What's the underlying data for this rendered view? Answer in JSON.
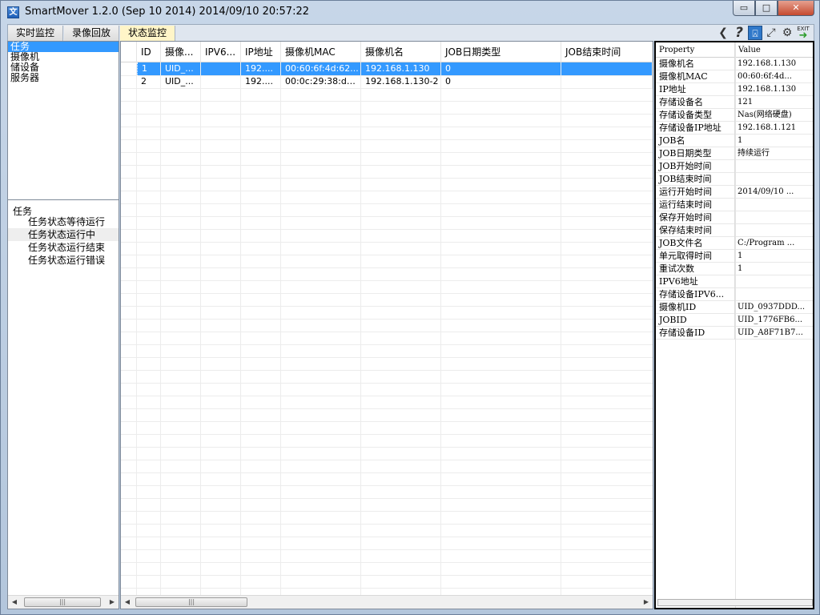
{
  "window": {
    "title": "SmartMover 1.2.0 (Sep 10 2014) 2014/09/10 20:57:22",
    "app_icon": "文",
    "controls": {
      "minimize": "▭",
      "maximize": "□",
      "close": "✕"
    }
  },
  "tabs": [
    {
      "label": "实时监控",
      "active": false
    },
    {
      "label": "录像回放",
      "active": false
    },
    {
      "label": "状态监控",
      "active": true
    }
  ],
  "toolbar": {
    "back_glyph": "❮",
    "help_glyph": "?",
    "user_glyph": "⍓",
    "fullscreen_glyph": "⤢",
    "settings_glyph": "⚙",
    "exit_label": "EXIT",
    "exit_arrow": "➜"
  },
  "categories": [
    {
      "label": "任务",
      "selected": true
    },
    {
      "label": "摄像机",
      "selected": false
    },
    {
      "label": "储设备",
      "selected": false
    },
    {
      "label": "服务器",
      "selected": false
    }
  ],
  "tree": {
    "root": "任务",
    "children": [
      {
        "label": "任务状态等待运行",
        "selected": false
      },
      {
        "label": "任务状态运行中",
        "selected": true
      },
      {
        "label": "任务状态运行结束",
        "selected": false
      },
      {
        "label": "任务状态运行错误",
        "selected": false
      }
    ]
  },
  "grid": {
    "columns": [
      "ID",
      "摄像...",
      "IPV6...",
      "IP地址",
      "摄像机MAC",
      "摄像机名",
      "JOB日期类型",
      "JOB结束时间"
    ],
    "rows": [
      {
        "id": "1",
        "cells": [
          "UID_...",
          "",
          "192....",
          "00:60:6f:4d:62...",
          "192.168.1.130",
          "0",
          ""
        ],
        "selected": true
      },
      {
        "id": "2",
        "cells": [
          "UID_...",
          "",
          "192....",
          "00:0c:29:38:da...",
          "192.168.1.130-2",
          "0",
          ""
        ],
        "selected": false
      }
    ]
  },
  "properties": {
    "header": {
      "key": "Property",
      "value": "Value"
    },
    "items": [
      {
        "key": "摄像机名",
        "value": "192.168.1.130"
      },
      {
        "key": "摄像机MAC",
        "value": "00:60:6f:4d..."
      },
      {
        "key": "IP地址",
        "value": "192.168.1.130"
      },
      {
        "key": "存储设备名",
        "value": "121"
      },
      {
        "key": "存储设备类型",
        "value": "Nas(网络硬盘)"
      },
      {
        "key": "存储设备IP地址",
        "value": "192.168.1.121"
      },
      {
        "key": "JOB名",
        "value": "1"
      },
      {
        "key": "JOB日期类型",
        "value": "持续运行"
      },
      {
        "key": "JOB开始时间",
        "value": ""
      },
      {
        "key": "JOB结束时间",
        "value": ""
      },
      {
        "key": "运行开始时间",
        "value": "2014/09/10 ..."
      },
      {
        "key": "运行结束时间",
        "value": ""
      },
      {
        "key": "保存开始时间",
        "value": ""
      },
      {
        "key": "保存结束时间",
        "value": ""
      },
      {
        "key": "JOB文件名",
        "value": "C:/Program ..."
      },
      {
        "key": "单元取得时间",
        "value": "1"
      },
      {
        "key": "重试次数",
        "value": "1"
      },
      {
        "key": "IPV6地址",
        "value": ""
      },
      {
        "key": "存储设备IPV6...",
        "value": ""
      },
      {
        "key": "摄像机ID",
        "value": "UID_0937DDD..."
      },
      {
        "key": "JOBID",
        "value": "UID_1776FB6..."
      },
      {
        "key": "存储设备ID",
        "value": "UID_A8F71B7..."
      }
    ]
  },
  "scrollbars": {
    "left_arrow": "◀",
    "right_arrow": "▶",
    "grip": "|||"
  }
}
